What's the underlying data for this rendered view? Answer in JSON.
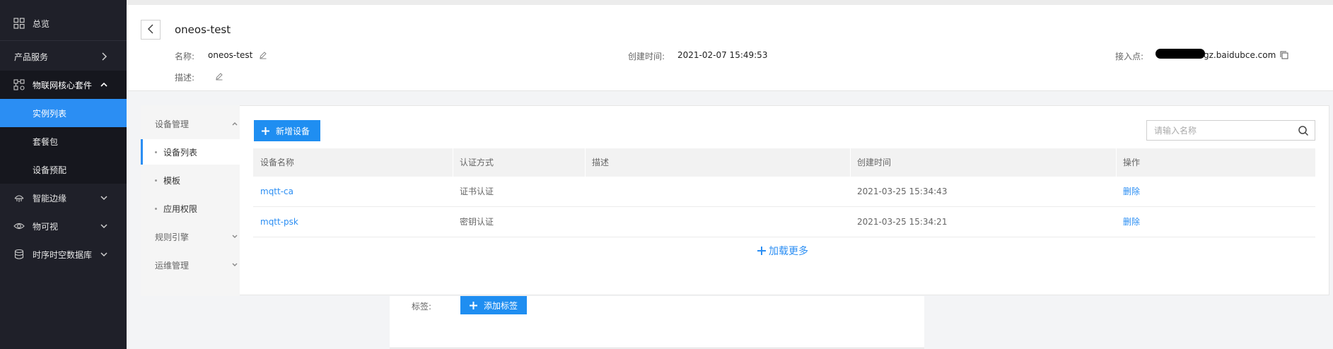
{
  "sidebar": {
    "items": [
      {
        "label": "总览",
        "icon": "grid-icon"
      },
      {
        "label": "产品服务",
        "icon": "chevron-right-icon"
      },
      {
        "label": "物联网核心套件",
        "icon": "nodes-icon"
      },
      {
        "label": "实例列表"
      },
      {
        "label": "套餐包"
      },
      {
        "label": "设备预配"
      },
      {
        "label": "智能边缘",
        "icon": "edge-icon"
      },
      {
        "label": "物可视",
        "icon": "eye-icon"
      },
      {
        "label": "时序时空数据库",
        "icon": "database-icon"
      }
    ]
  },
  "header": {
    "title": "oneos-test",
    "name_label": "名称:",
    "name_value": "oneos-test",
    "desc_label": "描述:",
    "created_label": "创建时间:",
    "created_value": "2021-02-07 15:49:53",
    "endpoint_label": "接入点:",
    "endpoint_value": "gz.baidubce.com"
  },
  "subnav": {
    "groups": [
      {
        "label": "设备管理"
      },
      {
        "label": "设备列表"
      },
      {
        "label": "模板"
      },
      {
        "label": "应用权限"
      },
      {
        "label": "规则引擎"
      },
      {
        "label": "运维管理"
      }
    ]
  },
  "toolbar": {
    "add_device_label": "新增设备",
    "search_placeholder": "请输入名称"
  },
  "table": {
    "columns": [
      "设备名称",
      "认证方式",
      "描述",
      "创建时间",
      "操作"
    ],
    "rows": [
      {
        "name": "mqtt-ca",
        "auth": "证书认证",
        "desc": "",
        "created": "2021-03-25 15:34:43",
        "action": "删除"
      },
      {
        "name": "mqtt-psk",
        "auth": "密钥认证",
        "desc": "",
        "created": "2021-03-25 15:34:21",
        "action": "删除"
      }
    ],
    "load_more": "加载更多"
  },
  "tags": {
    "label": "标签:",
    "add_label": "添加标签"
  },
  "colors": {
    "sidebar_bg": "#1f2029",
    "accent": "#2b8ef3"
  }
}
